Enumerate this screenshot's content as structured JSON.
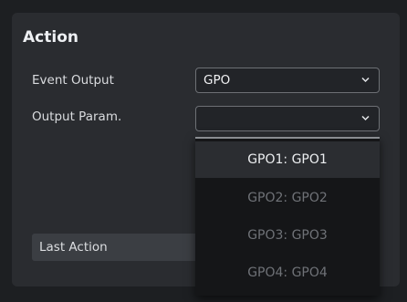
{
  "section": {
    "title": "Action"
  },
  "event_output": {
    "label": "Event Output",
    "value": "GPO"
  },
  "output_param": {
    "label": "Output Param.",
    "value": ""
  },
  "last_action": {
    "label": "Last Action"
  },
  "dropdown": {
    "options": [
      {
        "label": "GPO1: GPO1",
        "selected": true
      },
      {
        "label": "GPO2: GPO2",
        "selected": false
      },
      {
        "label": "GPO3: GPO3",
        "selected": false
      },
      {
        "label": "GPO4: GPO4",
        "selected": false
      }
    ]
  },
  "icons": {
    "select_chevron": "chevron-down-icon"
  },
  "colors": {
    "panel_bg": "#2a2c30",
    "page_bg": "#1d1f22",
    "dropdown_bg": "#151618",
    "option_active_bg": "#2b2d31",
    "option_inactive_text": "#6f7277",
    "option_active_text": "#eceef0"
  }
}
